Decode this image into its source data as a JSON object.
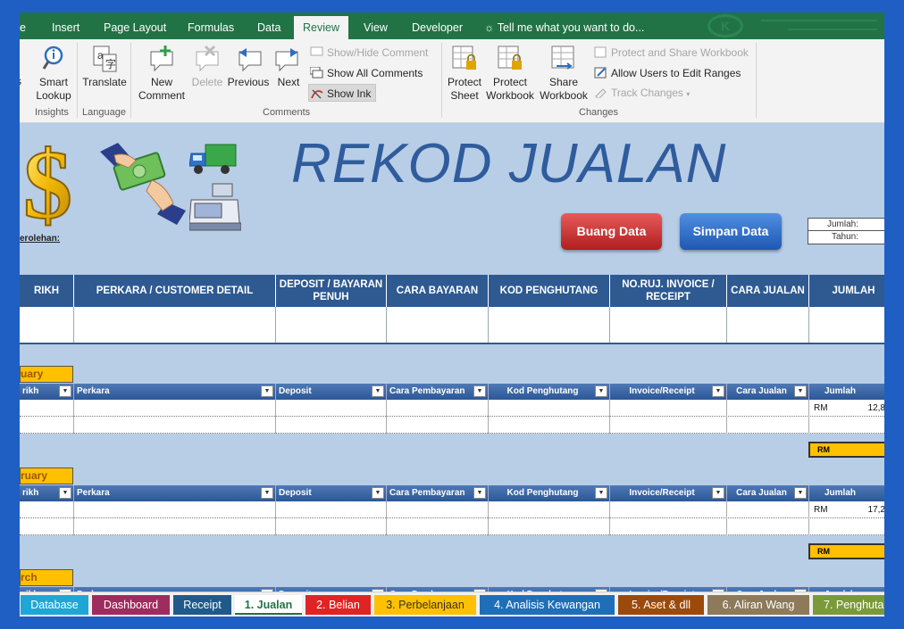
{
  "ribbon_tabs": [
    "e",
    "Insert",
    "Page Layout",
    "Formulas",
    "Data",
    "Review",
    "View",
    "Developer",
    "Tell me what you want to do..."
  ],
  "active_tab": "Review",
  "ribbon": {
    "s_label": "s",
    "smart_lookup": "Smart Lookup",
    "translate": "Translate",
    "new_comment": "New Comment",
    "delete": "Delete",
    "previous": "Previous",
    "next": "Next",
    "show_hide_comment": "Show/Hide Comment",
    "show_all_comments": "Show All Comments",
    "show_ink": "Show Ink",
    "protect_sheet": "Protect Sheet",
    "protect_workbook": "Protect Workbook",
    "share_workbook": "Share Workbook",
    "protect_and_share": "Protect and Share Workbook",
    "allow_users": "Allow Users to Edit Ranges",
    "track_changes": "Track Changes",
    "groups": {
      "insights": "Insights",
      "language": "Language",
      "comments": "Comments",
      "changes": "Changes"
    }
  },
  "sheet": {
    "title": "REKOD JUALAN",
    "perolehan_label": "erolehan:",
    "buang_button": "Buang Data",
    "simpan_button": "Simpan Data",
    "info_jumlah": "Jumlah:",
    "info_tahun": "Tahun:",
    "headers": [
      "RIKH",
      "PERKARA / CUSTOMER DETAIL",
      "DEPOSIT / BAYARAN PENUH",
      "CARA BAYARAN",
      "KOD PENGHUTANG",
      "NO.RUJ. INVOICE / RECEIPT",
      "CARA JUALAN",
      "JUMLAH"
    ],
    "filter_headers": [
      "rikh",
      "Perkara",
      "Deposit",
      "Cara Pembayaran",
      "Kod Penghutang",
      "Invoice/Receipt",
      "Cara Jualan",
      "Jumlah"
    ],
    "months": [
      {
        "label": "uary",
        "rm": "RM",
        "amount": "12,8",
        "total_label": "RM"
      },
      {
        "label": "ruary",
        "rm": "RM",
        "amount": "17,2",
        "total_label": "RM"
      },
      {
        "label": "rch",
        "rm": "",
        "amount": "",
        "total_label": ""
      }
    ]
  },
  "sheet_tabs": [
    {
      "label": "Database",
      "color": "#1fa6d6"
    },
    {
      "label": "Dashboard",
      "color": "#a02b5e"
    },
    {
      "label": "Receipt",
      "color": "#1f5a8a"
    },
    {
      "label": "1. Jualan",
      "color": "#217346"
    },
    {
      "label": "2. Belian",
      "color": "#e02424"
    },
    {
      "label": "3. Perbelanjaan",
      "color": "#ffc000"
    },
    {
      "label": "4. Analisis Kewangan",
      "color": "#1f6fb8"
    },
    {
      "label": "5. Aset & dll",
      "color": "#9c4a0c"
    },
    {
      "label": "6. Aliran Wang",
      "color": "#8c7a5a"
    },
    {
      "label": "7. Penghuta",
      "color": "#7a9a3a"
    }
  ],
  "active_sheet_tab": "1. Jualan"
}
